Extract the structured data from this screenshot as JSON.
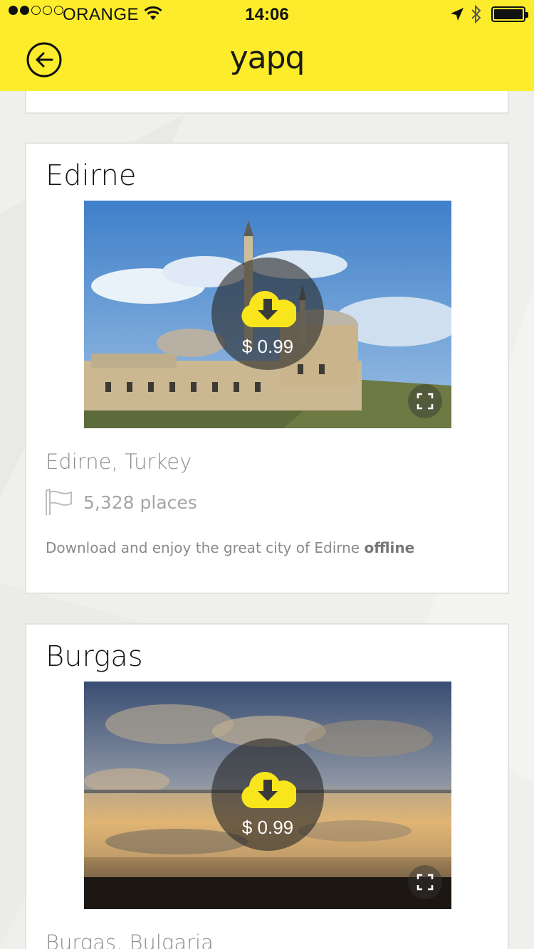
{
  "status_bar": {
    "carrier": "ORANGE",
    "time": "14:06",
    "signal_bars_filled": 2,
    "signal_bars_total": 5
  },
  "header": {
    "logo_text": "yapq",
    "back_icon": "back-arrow-circle-icon",
    "background_color": "#fcec2c"
  },
  "cards": [
    {
      "title": "Edirne",
      "price": "$ 0.99",
      "location": "Edirne, Turkey",
      "places": "5,328 places",
      "description": "Download and enjoy the great city of Edirne",
      "description_bold": "offline"
    },
    {
      "title": "Burgas",
      "price": "$ 0.99",
      "location": "Burgas, Bulgaria"
    }
  ],
  "icons": {
    "download": "cloud-download-icon",
    "expand": "expand-icon",
    "places": "flag-icon"
  },
  "colors": {
    "accent": "#fcec2c",
    "icon_yellow": "#f8e51c"
  }
}
